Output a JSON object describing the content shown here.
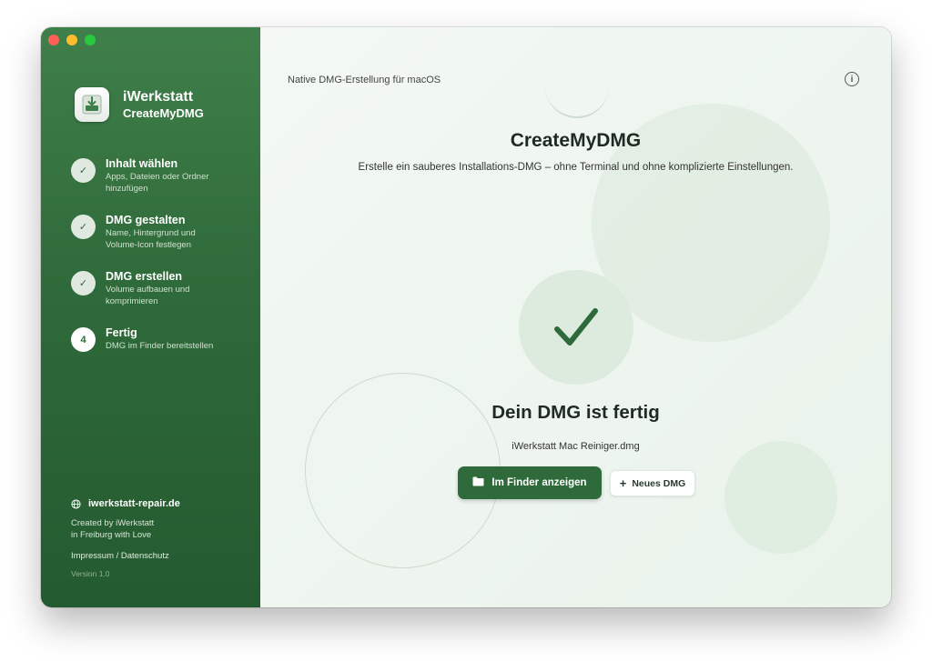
{
  "app": {
    "brand_line1": "iWerkstatt",
    "brand_line2": "CreateMyDMG",
    "icon": "app-icon-disk-download"
  },
  "sidebar": {
    "steps": [
      {
        "marker": "✓",
        "title": "Inhalt wählen",
        "desc": "Apps, Dateien oder Ordner hinzufügen",
        "state": "done"
      },
      {
        "marker": "✓",
        "title": "DMG gestalten",
        "desc": "Name, Hintergrund und Volume-Icon festlegen",
        "state": "done"
      },
      {
        "marker": "✓",
        "title": "DMG erstellen",
        "desc": "Volume aufbauen und komprimieren",
        "state": "done"
      },
      {
        "marker": "4",
        "title": "Fertig",
        "desc": "DMG im Finder bereitstellen",
        "state": "current"
      }
    ],
    "footer": {
      "site": "iwerkstatt-repair.de",
      "credit_line1": "Created by iWerkstatt",
      "credit_line2": "in Freiburg with Love",
      "legal": "Impressum / Datenschutz",
      "version": "Version 1.0"
    }
  },
  "main": {
    "header_subtitle": "Native DMG-Erstellung für macOS",
    "title": "CreateMyDMG",
    "tagline": "Erstelle ein sauberes Installations-DMG – ohne Terminal und ohne komplizierte Einstellungen.",
    "done_title": "Dein DMG ist fertig",
    "filename": "iWerkstatt Mac Reiniger.dmg",
    "primary_button": "Im Finder anzeigen",
    "secondary_button": "Neues DMG",
    "secondary_button_icon": "+"
  },
  "colors": {
    "accent": "#2f6a3a",
    "sidebar_top": "#3f7f4a",
    "sidebar_bottom": "#245a30",
    "check": "#2f6a3a"
  }
}
